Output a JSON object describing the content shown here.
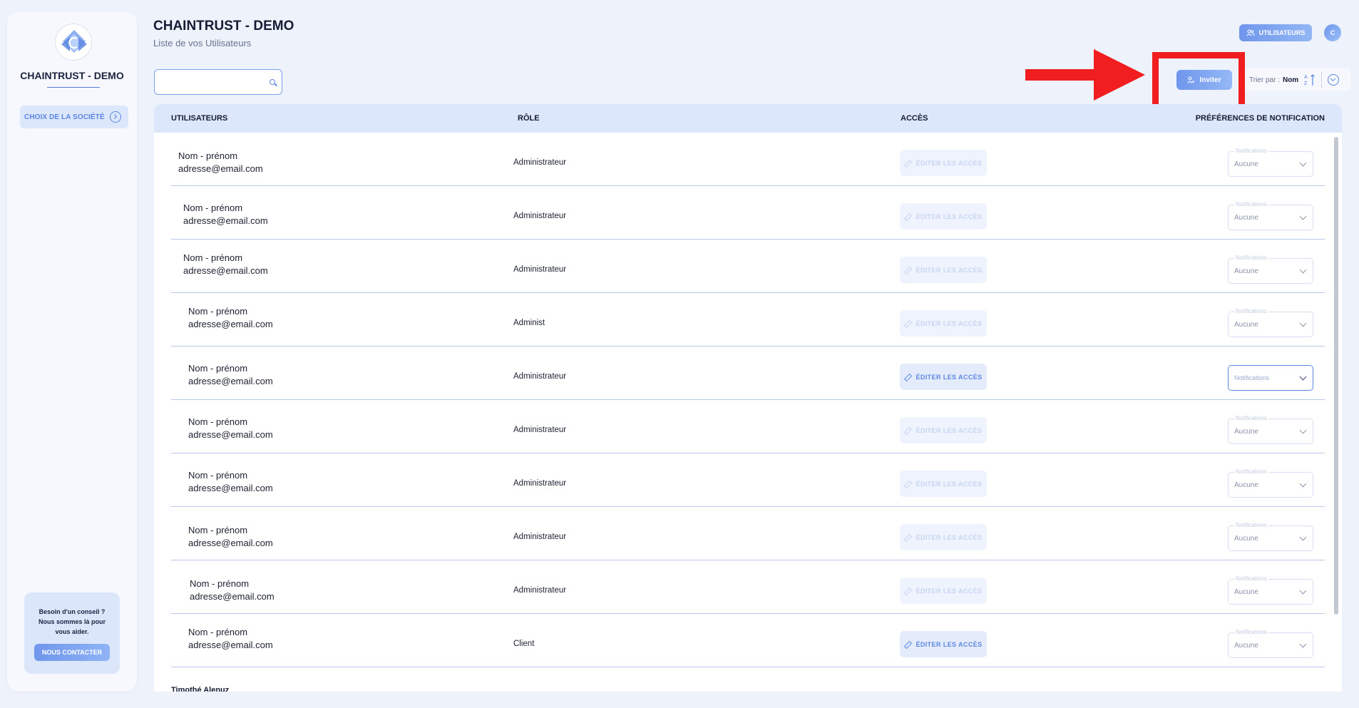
{
  "sidebar": {
    "company_name": "CHAINTRUST - DEMO",
    "choose_company_label": "CHOIX DE LA SOCIÉTÉ",
    "help_text": "Besoin d'un conseil ? Nous sommes là pour vous aider.",
    "contact_label": "NOUS CONTACTER"
  },
  "header": {
    "title": "CHAINTRUST - DEMO",
    "subtitle": "Liste de vos Utilisateurs",
    "users_badge": "UTILISATEURS",
    "avatar_initial": "C"
  },
  "search": {
    "placeholder": "",
    "value": ""
  },
  "toolbar": {
    "invite_label": "Inviter",
    "sort_label": "Trier par :",
    "sort_value": "Nom",
    "sort_icon": "az-ascending-icon"
  },
  "table": {
    "columns": {
      "users": "UTILISATEURS",
      "role": "RÔLE",
      "access": "ACCÈS",
      "notif_prefs": "PRÉFÉRENCES DE NOTIFICATION"
    },
    "edit_label": "ÉDITER LES ACCÈS",
    "notif_legend": "Notifications",
    "rows": [
      {
        "name": "Nom - prénom",
        "email": "adresse@email.com",
        "role": "Administrateur",
        "notif": "Aucune"
      },
      {
        "name": "Nom - prénom",
        "email": "adresse@email.com",
        "role": "Administrateur",
        "notif": "Aucune"
      },
      {
        "name": "Nom - prénom",
        "email": "adresse@email.com",
        "role": "Administrateur",
        "notif": "Aucune"
      },
      {
        "name": "Nom - prénom",
        "email": "adresse@email.com",
        "role": "Administ",
        "notif": "Aucune"
      },
      {
        "name": "Nom - prénom",
        "email": "adresse@email.com",
        "role": "Administrateur",
        "notif": "Notifications"
      },
      {
        "name": "Nom - prénom",
        "email": "adresse@email.com",
        "role": "Administrateur",
        "notif": "Aucune"
      },
      {
        "name": "Nom - prénom",
        "email": "adresse@email.com",
        "role": "Administrateur",
        "notif": "Aucune"
      },
      {
        "name": "Nom - prénom",
        "email": "adresse@email.com",
        "role": "Administrateur",
        "notif": "Aucune"
      },
      {
        "name": "Nom - prénom",
        "email": "adresse@email.com",
        "role": "Administrateur",
        "notif": "Aucune"
      },
      {
        "name": "Nom - prénom",
        "email": "adresse@email.com",
        "role": "Client",
        "notif": "Aucune"
      }
    ],
    "partial_row_name": "Timothé Alenuz"
  },
  "colors": {
    "accent": "#5b86e0",
    "highlight": "#f01e1e",
    "header_row": "#dce7fb"
  }
}
